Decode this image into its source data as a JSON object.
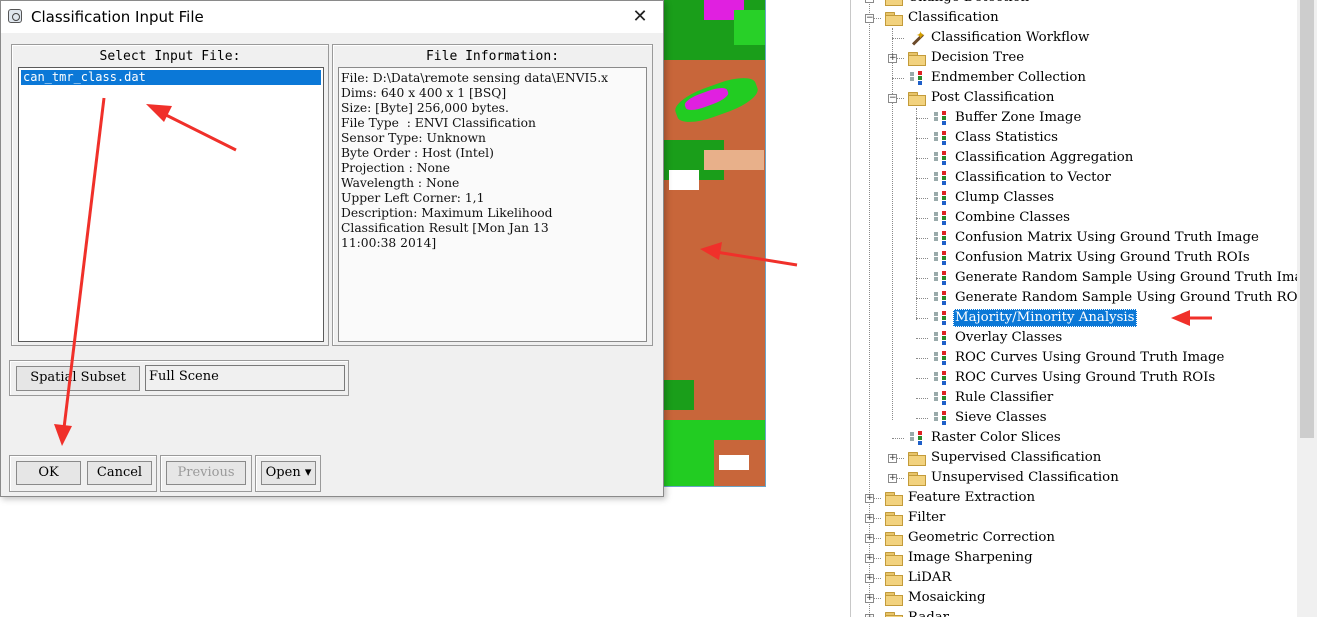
{
  "dialog": {
    "title": "Classification Input File",
    "select_label": "Select Input File:",
    "files": [
      "can_tmr_class.dat"
    ],
    "info_label": "File Information:",
    "info_lines": [
      "File: D:\\Data\\remote sensing data\\ENVI5.x",
      "Dims: 640 x 400 x 1 [BSQ]",
      "Size: [Byte] 256,000 bytes.",
      "File Type  : ENVI Classification",
      "Sensor Type: Unknown",
      "Byte Order : Host (Intel)",
      "Projection : None",
      "Wavelength : None",
      "Upper Left Corner: 1,1",
      "Description: Maximum Likelihood",
      "Classification Result [Mon Jan 13",
      "11:00:38 2014]"
    ],
    "spatial_subset_label": "Spatial Subset",
    "spatial_subset_value": "Full Scene",
    "ok_label": "OK",
    "cancel_label": "Cancel",
    "previous_label": "Previous",
    "open_label": "Open ▾"
  },
  "tree": [
    {
      "label": "Change Detection",
      "level": 0,
      "type": "folder",
      "exp": "+"
    },
    {
      "label": "Classification",
      "level": 0,
      "type": "folder",
      "exp": "−"
    },
    {
      "label": "Classification Workflow",
      "level": 1,
      "type": "wand"
    },
    {
      "label": "Decision Tree",
      "level": 1,
      "type": "folder",
      "exp": "+"
    },
    {
      "label": "Endmember Collection",
      "level": 1,
      "type": "tool"
    },
    {
      "label": "Post Classification",
      "level": 1,
      "type": "folder",
      "exp": "−"
    },
    {
      "label": "Buffer Zone Image",
      "level": 2,
      "type": "tool"
    },
    {
      "label": "Class Statistics",
      "level": 2,
      "type": "tool"
    },
    {
      "label": "Classification Aggregation",
      "level": 2,
      "type": "tool"
    },
    {
      "label": "Classification to Vector",
      "level": 2,
      "type": "tool"
    },
    {
      "label": "Clump Classes",
      "level": 2,
      "type": "tool"
    },
    {
      "label": "Combine Classes",
      "level": 2,
      "type": "tool"
    },
    {
      "label": "Confusion Matrix Using Ground Truth Image",
      "level": 2,
      "type": "tool"
    },
    {
      "label": "Confusion Matrix Using Ground Truth ROIs",
      "level": 2,
      "type": "tool"
    },
    {
      "label": "Generate Random Sample Using Ground Truth Imag",
      "level": 2,
      "type": "tool"
    },
    {
      "label": "Generate Random Sample Using Ground Truth ROIs",
      "level": 2,
      "type": "tool"
    },
    {
      "label": "Majority/Minority Analysis",
      "level": 2,
      "type": "tool",
      "selected": true
    },
    {
      "label": "Overlay Classes",
      "level": 2,
      "type": "tool"
    },
    {
      "label": "ROC Curves Using Ground Truth Image",
      "level": 2,
      "type": "tool"
    },
    {
      "label": "ROC Curves Using Ground Truth ROIs",
      "level": 2,
      "type": "tool"
    },
    {
      "label": "Rule Classifier",
      "level": 2,
      "type": "tool"
    },
    {
      "label": "Sieve Classes",
      "level": 2,
      "type": "tool"
    },
    {
      "label": "Raster Color Slices",
      "level": 1,
      "type": "tool"
    },
    {
      "label": "Supervised Classification",
      "level": 1,
      "type": "folder",
      "exp": "+"
    },
    {
      "label": "Unsupervised Classification",
      "level": 1,
      "type": "folder",
      "exp": "+"
    },
    {
      "label": "Feature Extraction",
      "level": 0,
      "type": "folder",
      "exp": "+"
    },
    {
      "label": "Filter",
      "level": 0,
      "type": "folder",
      "exp": "+"
    },
    {
      "label": "Geometric Correction",
      "level": 0,
      "type": "folder",
      "exp": "+"
    },
    {
      "label": "Image Sharpening",
      "level": 0,
      "type": "folder",
      "exp": "+"
    },
    {
      "label": "LiDAR",
      "level": 0,
      "type": "folder",
      "exp": "+"
    },
    {
      "label": "Mosaicking",
      "level": 0,
      "type": "folder",
      "exp": "+"
    },
    {
      "label": "Radar",
      "level": 0,
      "type": "folder",
      "exp": "+"
    }
  ],
  "colors": {
    "selection": "#0b78d7",
    "annotation_arrow": "#f0302a",
    "class_brown": "#c8663a",
    "class_green": "#22cc22",
    "class_magenta": "#e020e0"
  }
}
